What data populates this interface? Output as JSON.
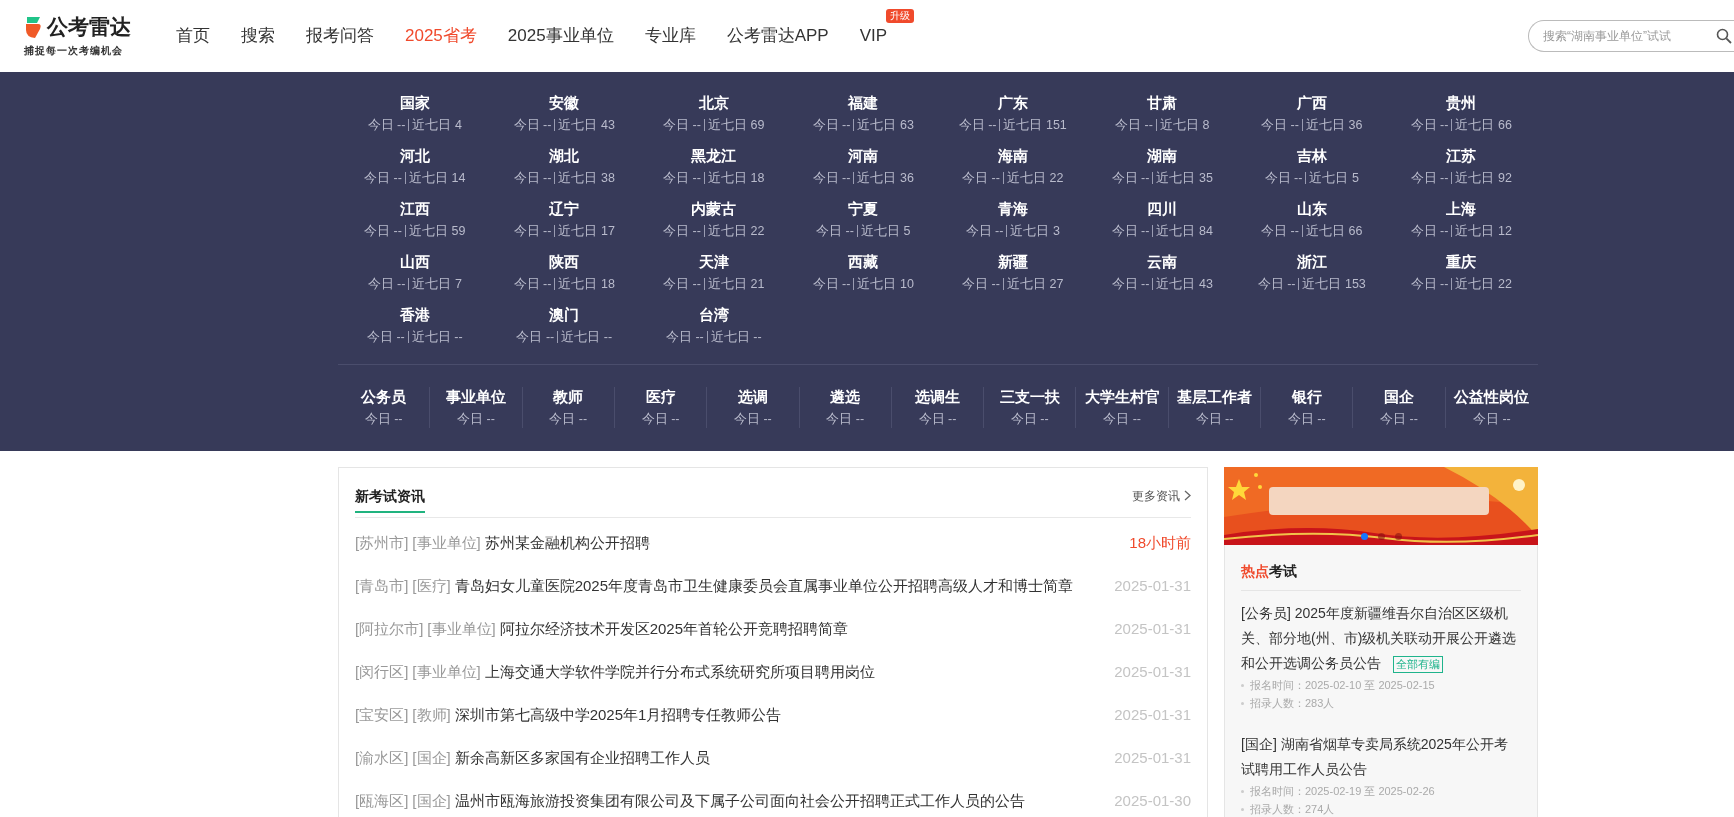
{
  "logo": {
    "name": "公考雷达",
    "slogan": "捕捉每一次考编机会"
  },
  "nav": [
    {
      "label": "首页",
      "selected": false
    },
    {
      "label": "搜索",
      "selected": false
    },
    {
      "label": "报考问答",
      "selected": false
    },
    {
      "label": "2025省考",
      "selected": true
    },
    {
      "label": "2025事业单位",
      "selected": false
    },
    {
      "label": "专业库",
      "selected": false
    },
    {
      "label": "公考雷达APP",
      "selected": false
    },
    {
      "label": "VIP",
      "selected": false,
      "badge": "升级"
    }
  ],
  "search": {
    "placeholder": "搜索“湖南事业单位”试试"
  },
  "regions": [
    {
      "name": "国家",
      "today": "今日 --",
      "week": "近七日 4"
    },
    {
      "name": "安徽",
      "today": "今日 --",
      "week": "近七日 43"
    },
    {
      "name": "北京",
      "today": "今日 --",
      "week": "近七日 69"
    },
    {
      "name": "福建",
      "today": "今日 --",
      "week": "近七日 63"
    },
    {
      "name": "广东",
      "today": "今日 --",
      "week": "近七日 151"
    },
    {
      "name": "甘肃",
      "today": "今日 --",
      "week": "近七日 8"
    },
    {
      "name": "广西",
      "today": "今日 --",
      "week": "近七日 36"
    },
    {
      "name": "贵州",
      "today": "今日 --",
      "week": "近七日 66"
    },
    {
      "name": "河北",
      "today": "今日 --",
      "week": "近七日 14"
    },
    {
      "name": "湖北",
      "today": "今日 --",
      "week": "近七日 38"
    },
    {
      "name": "黑龙江",
      "today": "今日 --",
      "week": "近七日 18"
    },
    {
      "name": "河南",
      "today": "今日 --",
      "week": "近七日 36"
    },
    {
      "name": "海南",
      "today": "今日 --",
      "week": "近七日 22"
    },
    {
      "name": "湖南",
      "today": "今日 --",
      "week": "近七日 35"
    },
    {
      "name": "吉林",
      "today": "今日 --",
      "week": "近七日 5"
    },
    {
      "name": "江苏",
      "today": "今日 --",
      "week": "近七日 92"
    },
    {
      "name": "江西",
      "today": "今日 --",
      "week": "近七日 59"
    },
    {
      "name": "辽宁",
      "today": "今日 --",
      "week": "近七日 17"
    },
    {
      "name": "内蒙古",
      "today": "今日 --",
      "week": "近七日 22"
    },
    {
      "name": "宁夏",
      "today": "今日 --",
      "week": "近七日 5"
    },
    {
      "name": "青海",
      "today": "今日 --",
      "week": "近七日 3"
    },
    {
      "name": "四川",
      "today": "今日 --",
      "week": "近七日 84"
    },
    {
      "name": "山东",
      "today": "今日 --",
      "week": "近七日 66"
    },
    {
      "name": "上海",
      "today": "今日 --",
      "week": "近七日 12"
    },
    {
      "name": "山西",
      "today": "今日 --",
      "week": "近七日 7"
    },
    {
      "name": "陕西",
      "today": "今日 --",
      "week": "近七日 18"
    },
    {
      "name": "天津",
      "today": "今日 --",
      "week": "近七日 21"
    },
    {
      "name": "西藏",
      "today": "今日 --",
      "week": "近七日 10"
    },
    {
      "name": "新疆",
      "today": "今日 --",
      "week": "近七日 27"
    },
    {
      "name": "云南",
      "today": "今日 --",
      "week": "近七日 43"
    },
    {
      "name": "浙江",
      "today": "今日 --",
      "week": "近七日 153"
    },
    {
      "name": "重庆",
      "today": "今日 --",
      "week": "近七日 22"
    },
    {
      "name": "香港",
      "today": "今日 --",
      "week": "近七日 --"
    },
    {
      "name": "澳门",
      "today": "今日 --",
      "week": "近七日 --"
    },
    {
      "name": "台湾",
      "today": "今日 --",
      "week": "近七日 --"
    }
  ],
  "categories": [
    {
      "name": "公务员",
      "today": "今日 --"
    },
    {
      "name": "事业单位",
      "today": "今日 --"
    },
    {
      "name": "教师",
      "today": "今日 --"
    },
    {
      "name": "医疗",
      "today": "今日 --"
    },
    {
      "name": "选调",
      "today": "今日 --"
    },
    {
      "name": "遴选",
      "today": "今日 --"
    },
    {
      "name": "选调生",
      "today": "今日 --"
    },
    {
      "name": "三支一扶",
      "today": "今日 --"
    },
    {
      "name": "大学生村官",
      "today": "今日 --"
    },
    {
      "name": "基层工作者",
      "today": "今日 --"
    },
    {
      "name": "银行",
      "today": "今日 --"
    },
    {
      "name": "国企",
      "today": "今日 --"
    },
    {
      "name": "公益性岗位",
      "today": "今日 --"
    }
  ],
  "news": {
    "title": "新考试资讯",
    "more": "更多资讯",
    "items": [
      {
        "region": "[苏州市]",
        "category": "[事业单位]",
        "title": "苏州某金融机构公开招聘",
        "time": "18小时前",
        "kind": "recent"
      },
      {
        "region": "[青岛市]",
        "category": "[医疗]",
        "title": "青岛妇女儿童医院2025年度青岛市卫生健康委员会直属事业单位公开招聘高级人才和博士简章",
        "time": "2025-01-31",
        "kind": "date"
      },
      {
        "region": "[阿拉尔市]",
        "category": "[事业单位]",
        "title": "阿拉尔经济技术开发区2025年首轮公开竞聘招聘简章",
        "time": "2025-01-31",
        "kind": "date"
      },
      {
        "region": "[闵行区]",
        "category": "[事业单位]",
        "title": "上海交通大学软件学院并行分布式系统研究所项目聘用岗位",
        "time": "2025-01-31",
        "kind": "date"
      },
      {
        "region": "[宝安区]",
        "category": "[教师]",
        "title": "深圳市第七高级中学2025年1月招聘专任教师公告",
        "time": "2025-01-31",
        "kind": "date"
      },
      {
        "region": "[渝水区]",
        "category": "[国企]",
        "title": "新余高新区多家国有企业招聘工作人员",
        "time": "2025-01-31",
        "kind": "date"
      },
      {
        "region": "[瓯海区]",
        "category": "[国企]",
        "title": "温州市瓯海旅游投资集团有限公司及下属子公司面向社会公开招聘正式工作人员的公告",
        "time": "2025-01-30",
        "kind": "date"
      }
    ]
  },
  "banner": {
    "kind": "picture",
    "dots": [
      {
        "selected": true
      },
      {
        "selected": false
      },
      {
        "selected": false
      }
    ]
  },
  "hot": {
    "title_accent": "热点",
    "title_rest": "考试",
    "items": [
      {
        "title": "[公务员] 2025年度新疆维吾尔自治区区级机关、部分地(州、市)级机关联动开展公开遴选和公开选调公务员公告",
        "badge": "全部有编",
        "dates": "报名时间：2025-02-10 至 2025-02-15",
        "count": "招录人数：283人"
      },
      {
        "title": "[国企] 湖南省烟草专卖局系统2025年公开考试聘用工作人员公告",
        "dates": "报名时间：2025-02-19 至 2025-02-26",
        "count": "招录人数：274人"
      }
    ]
  }
}
